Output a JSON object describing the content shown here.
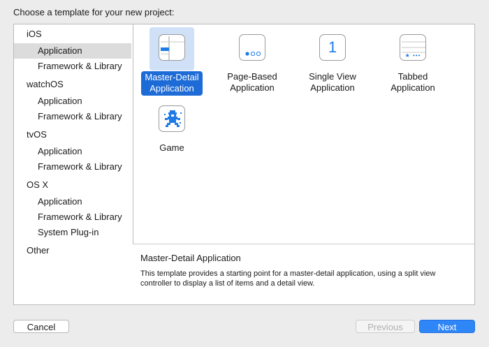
{
  "prompt": "Choose a template for your new project:",
  "sidebar": {
    "groups": [
      {
        "heading": "iOS",
        "items": [
          "Application",
          "Framework & Library"
        ]
      },
      {
        "heading": "watchOS",
        "items": [
          "Application",
          "Framework & Library"
        ]
      },
      {
        "heading": "tvOS",
        "items": [
          "Application",
          "Framework & Library"
        ]
      },
      {
        "heading": "OS X",
        "items": [
          "Application",
          "Framework & Library",
          "System Plug-in"
        ]
      },
      {
        "heading": "Other",
        "items": []
      }
    ],
    "selected": "iOS / Application"
  },
  "templates": [
    {
      "label": "Master-Detail\nApplication",
      "icon": "master-detail-icon",
      "selected": true
    },
    {
      "label": "Page-Based\nApplication",
      "icon": "page-based-icon",
      "selected": false
    },
    {
      "label": "Single View\nApplication",
      "icon": "single-view-icon",
      "selected": false,
      "glyph": "1"
    },
    {
      "label": "Tabbed\nApplication",
      "icon": "tabbed-icon",
      "selected": false,
      "glyph": "★ •••"
    },
    {
      "label": "Game",
      "icon": "game-icon",
      "selected": false
    }
  ],
  "description": {
    "title": "Master-Detail Application",
    "text": "This template provides a starting point for a master-detail application, using a split view controller to display a list of items and a detail view."
  },
  "buttons": {
    "cancel": "Cancel",
    "previous": "Previous",
    "next": "Next"
  },
  "colors": {
    "accent": "#2f86f6",
    "selection": "#1d6bd6",
    "icon_blue": "#1e7be6"
  }
}
